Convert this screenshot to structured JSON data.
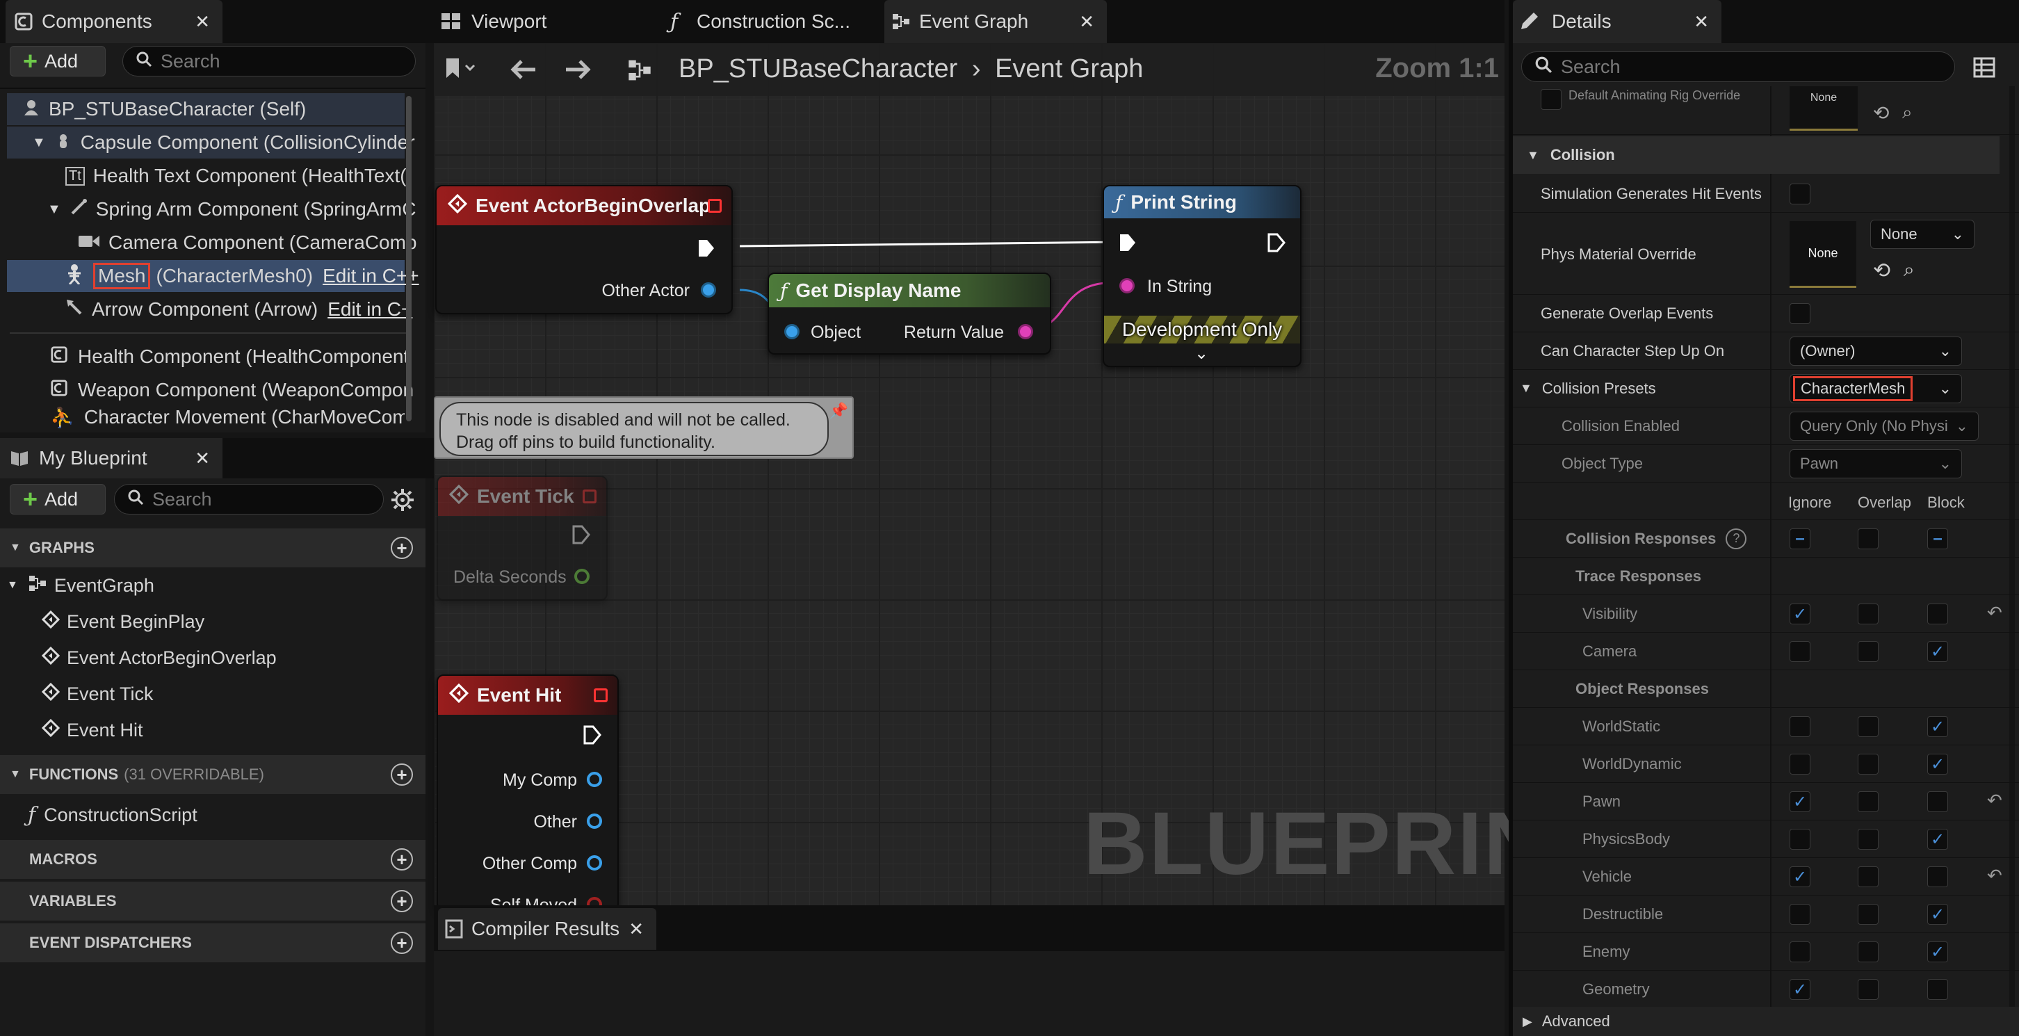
{
  "components": {
    "tab_title": "Components",
    "add_label": "Add",
    "search_placeholder": "Search",
    "items": [
      {
        "label": "BP_STUBaseCharacter (Self)",
        "edit": ""
      },
      {
        "label": "Capsule Component (CollisionCylinder",
        "edit": ""
      },
      {
        "label": "Health Text Component (HealthText(",
        "edit": ""
      },
      {
        "label": "Spring Arm Component (SpringArmC",
        "edit": ""
      },
      {
        "label": "Camera Component (CameraComp",
        "edit": ""
      },
      {
        "label": "Mesh",
        "label_rest": "(CharacterMesh0)",
        "edit": "Edit in C++"
      },
      {
        "label": "Arrow Component (Arrow)",
        "edit": "Edit in C+"
      },
      {
        "label": "Health Component (HealthComponent",
        "edit": ""
      },
      {
        "label": "Weapon Component (WeaponCompon",
        "edit": ""
      },
      {
        "label": "Character Movement (CharMoveComp",
        "edit": ""
      }
    ]
  },
  "my_blueprint": {
    "tab_title": "My Blueprint",
    "add_label": "Add",
    "search_placeholder": "Search",
    "graphs_label": "GRAPHS",
    "event_graph_label": "EventGraph",
    "events": [
      "Event BeginPlay",
      "Event ActorBeginOverlap",
      "Event Tick",
      "Event Hit"
    ],
    "functions_label": "FUNCTIONS",
    "functions_count": "(31 OVERRIDABLE)",
    "construction_script": "ConstructionScript",
    "macros_label": "MACROS",
    "variables_label": "VARIABLES",
    "dispatchers_label": "EVENT DISPATCHERS"
  },
  "editor_tabs": [
    {
      "label": "Viewport"
    },
    {
      "label": "Construction Sc..."
    },
    {
      "label": "Event Graph"
    }
  ],
  "breadcrumb": {
    "root": "BP_STUBaseCharacter",
    "separator": "›",
    "current": "Event Graph",
    "zoom": "Zoom 1:1"
  },
  "graph": {
    "watermark": "BLUEPRINT",
    "disabled_note_line1": "This node is disabled and will not be called.",
    "disabled_note_line2": "Drag off pins to build functionality.",
    "nodes": {
      "overlap": {
        "title": "Event ActorBeginOverlap",
        "pin": "Other Actor"
      },
      "display_name": {
        "title": "Get Display Name",
        "in_pin": "Object",
        "out_pin": "Return Value"
      },
      "print_string": {
        "title": "Print String",
        "in_pin": "In String",
        "footer": "Development Only"
      },
      "tick": {
        "title": "Event Tick",
        "pin": "Delta Seconds"
      },
      "hit": {
        "title": "Event Hit",
        "pins": [
          "My Comp",
          "Other",
          "Other Comp",
          "Self Moved"
        ]
      }
    }
  },
  "compiler": {
    "tab_title": "Compiler Results"
  },
  "details": {
    "tab_title": "Details",
    "search_placeholder": "Search",
    "top_row_label": "Default Animating Rig Override",
    "top_row_value": "None",
    "collision_section": "Collision",
    "sim_hit_events": "Simulation Generates Hit Events",
    "phys_material": "Phys Material Override",
    "phys_material_thumb": "None",
    "phys_material_value": "None",
    "overlap_events": "Generate Overlap Events",
    "step_up": "Can Character Step Up On",
    "step_up_value": "(Owner)",
    "presets": "Collision Presets",
    "presets_value": "CharacterMesh",
    "collision_enabled": "Collision Enabled",
    "collision_enabled_value": "Query Only (No Physi",
    "object_type": "Object Type",
    "object_type_value": "Pawn",
    "col_ignore": "Ignore",
    "col_overlap": "Overlap",
    "col_block": "Block",
    "collision_responses": "Collision Responses",
    "trace_responses": "Trace Responses",
    "object_responses": "Object Responses",
    "responses": [
      {
        "name": "Visibility",
        "ignore": true,
        "overlap": false,
        "block": false,
        "reset": true
      },
      {
        "name": "Camera",
        "ignore": false,
        "overlap": false,
        "block": true,
        "reset": false
      },
      {
        "name": "WorldStatic",
        "ignore": false,
        "overlap": false,
        "block": true,
        "reset": false
      },
      {
        "name": "WorldDynamic",
        "ignore": false,
        "overlap": false,
        "block": true,
        "reset": false
      },
      {
        "name": "Pawn",
        "ignore": true,
        "overlap": false,
        "block": false,
        "reset": true
      },
      {
        "name": "PhysicsBody",
        "ignore": false,
        "overlap": false,
        "block": true,
        "reset": false
      },
      {
        "name": "Vehicle",
        "ignore": true,
        "overlap": false,
        "block": false,
        "reset": true
      },
      {
        "name": "Destructible",
        "ignore": false,
        "overlap": false,
        "block": true,
        "reset": false
      },
      {
        "name": "Enemy",
        "ignore": false,
        "overlap": false,
        "block": true,
        "reset": false
      },
      {
        "name": "Geometry",
        "ignore": true,
        "overlap": false,
        "block": false,
        "reset": false
      }
    ],
    "advanced": "Advanced"
  }
}
